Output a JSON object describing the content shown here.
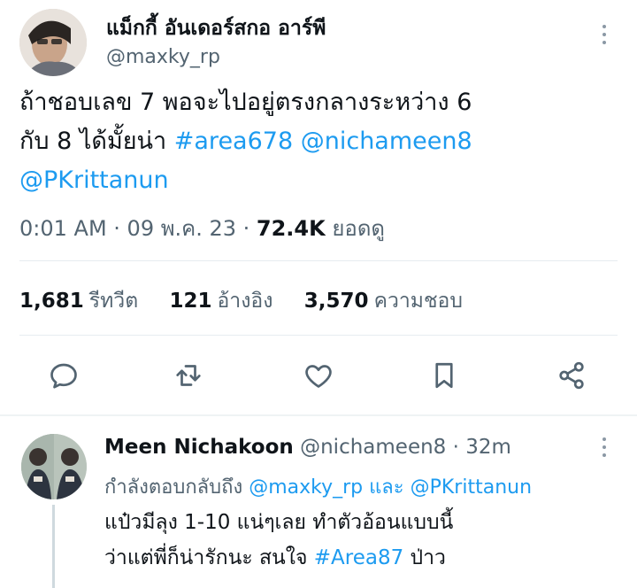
{
  "tweet": {
    "display_name": "แม็กกี้ อันเดอร์สกอ อาร์พี",
    "handle": "@maxky_rp",
    "text_line1": "ถ้าชอบเลข 7 พอจะไปอยู่ตรงกลางระหว่าง 6",
    "text_line2_plain": "กับ 8 ได้มั้ยน่า ",
    "hashtag": "#area678",
    "mention1": "@nichameen8",
    "mention2": "@PKrittanun",
    "time": "0:01 AM",
    "date": "09 พ.ค. 23",
    "views_count": "72.4K",
    "views_label": "ยอดดู"
  },
  "stats": {
    "retweets_count": "1,681",
    "retweets_label": "รีทวีต",
    "quotes_count": "121",
    "quotes_label": "อ้างอิง",
    "likes_count": "3,570",
    "likes_label": "ความชอบ"
  },
  "actions": {
    "icons": [
      "reply-icon",
      "retweet-icon",
      "like-icon",
      "bookmark-icon",
      "share-icon"
    ]
  },
  "reply": {
    "display_name": "Meen Nichakoon",
    "handle": "@nichameen8",
    "time": "32m",
    "replying_prefix": "กำลังตอบกลับถึง",
    "replying_user1": "@maxky_rp",
    "replying_and": "และ",
    "replying_user2": "@PKrittanun",
    "text_line1": "แป๋วมีลุง 1-10 แน่ๆเลย ทำตัวอ้อนแบบนี้",
    "text_line2_plain": "ว่าแต่พี่ก็น่ารักนะ สนใจ ",
    "hashtag": "#Area87",
    "text_line2_end": " ป่าว"
  },
  "colors": {
    "accent": "#1d9bf0",
    "text": "#0f1419",
    "secondary": "#536471",
    "divider": "#e6ecf0"
  }
}
